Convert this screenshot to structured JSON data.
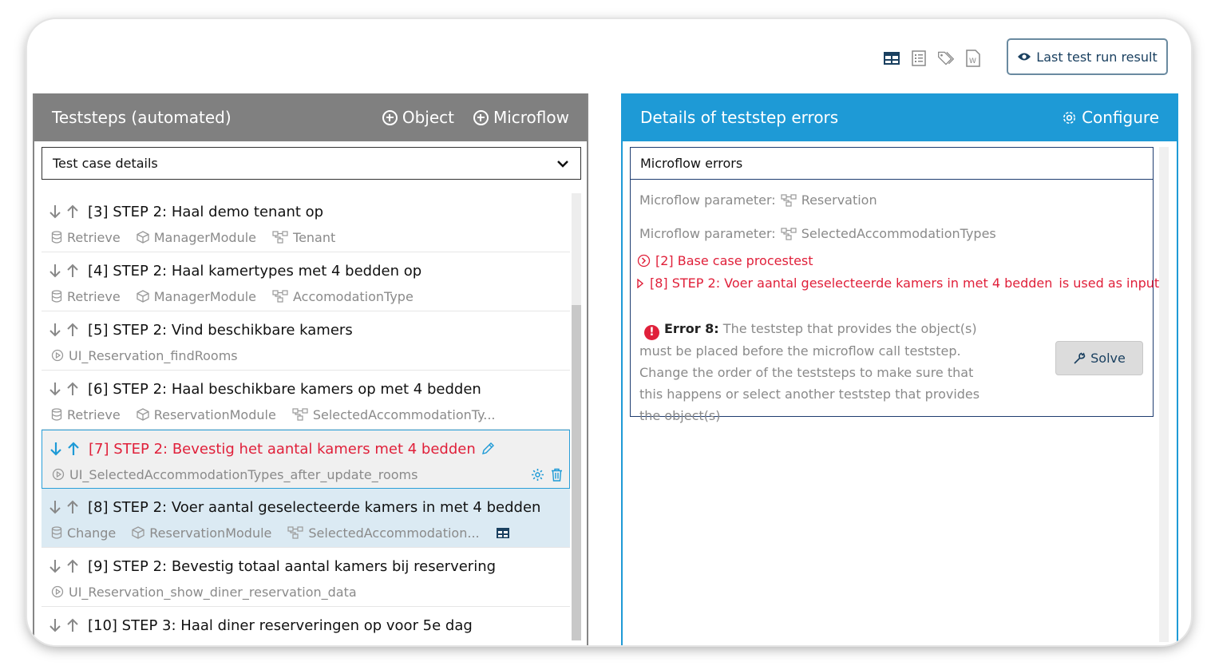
{
  "toolbar": {
    "last_run_label": "Last test run result"
  },
  "left": {
    "title": "Teststeps (automated)",
    "add_object": "Object",
    "add_microflow": "Microflow",
    "select_value": "Test case details",
    "steps": [
      {
        "title": "[3] STEP 2: Haal demo tenant op",
        "action": "Retrieve",
        "module": "ManagerModule",
        "entity": "Tenant"
      },
      {
        "title": "[4] STEP 2: Haal kamertypes met 4 bedden op",
        "action": "Retrieve",
        "module": "ManagerModule",
        "entity": "AccomodationType"
      },
      {
        "title": "[5] STEP 2: Vind beschikbare kamers",
        "microflow": "UI_Reservation_findRooms"
      },
      {
        "title": "[6] STEP 2: Haal beschikbare kamers op met 4 bedden",
        "action": "Retrieve",
        "module": "ReservationModule",
        "entity": "SelectedAccommodationTy..."
      },
      {
        "title": "[7] STEP 2: Bevestig het aantal kamers met 4 bedden",
        "microflow": "UI_SelectedAccommodationTypes_after_update_rooms"
      },
      {
        "title": "[8] STEP 2: Voer aantal geselecteerde kamers in met 4 bedden",
        "action": "Change",
        "module": "ReservationModule",
        "entity": "SelectedAccommodation..."
      },
      {
        "title": "[9] STEP 2: Bevestig totaal aantal kamers bij reservering",
        "microflow": "UI_Reservation_show_diner_reservation_data"
      },
      {
        "title": "[10] STEP 3: Haal diner reserveringen op voor 5e dag"
      }
    ]
  },
  "right": {
    "title": "Details of teststep errors",
    "configure": "Configure",
    "card_title": "Microflow errors",
    "param_label": "Microflow parameter:",
    "param1": "Reservation",
    "param2": "SelectedAccommodationTypes",
    "ref1": "[2] Base case procestest",
    "ref2": "[8] STEP 2: Voer aantal geselecteerde kamers in met 4 bedden",
    "ref2_suffix": "is used as input",
    "error_label": "Error 8:",
    "error_text": "The teststep that provides the object(s) must be placed before the microflow call teststep. Change the order of the teststeps to make sure that this happens or select another teststep that provides the object(s)",
    "solve": "Solve"
  },
  "colors": {
    "accent_blue": "#1e9ad6",
    "header_grey": "#808080",
    "error_red": "#e0203a",
    "selected_bg": "#dbeaf3"
  },
  "icons": [
    "table-icon",
    "list-icon",
    "tags-icon",
    "word-doc-icon",
    "eye-icon",
    "plus-circle-icon",
    "gear-icon",
    "chevron-down-icon",
    "arrow-down-icon",
    "arrow-up-icon",
    "database-icon",
    "cube-icon",
    "entity-icon",
    "play-circle-icon",
    "pencil-icon",
    "trash-icon",
    "wrench-icon",
    "error-icon"
  ]
}
